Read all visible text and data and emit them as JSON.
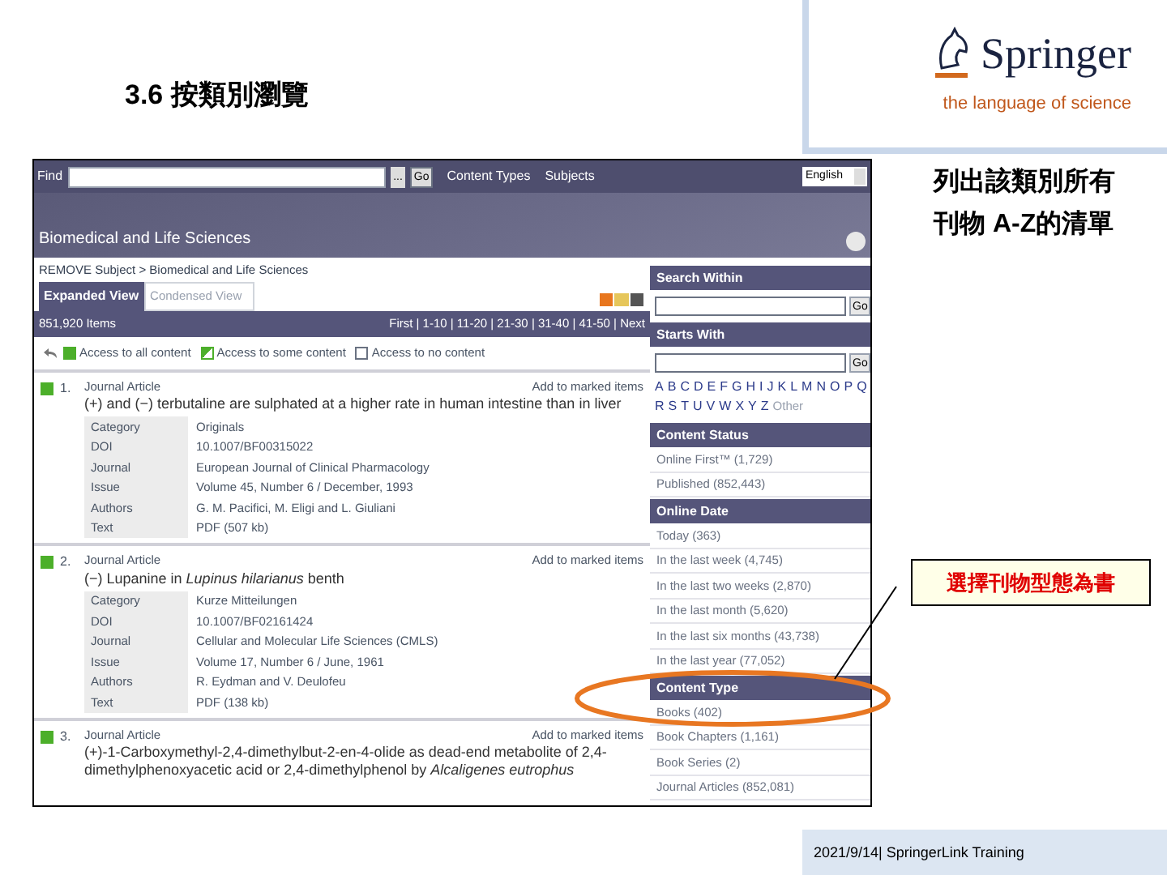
{
  "slide": {
    "title": "3.6 按類別瀏覽",
    "logo": {
      "name": "Springer",
      "tagline": "the language of science"
    },
    "note": "列出該類別所有刊物 A-Z的清單",
    "callout": "選擇刊物型態為書",
    "footer": "2021/9/14| SpringerLink Training"
  },
  "screen": {
    "top_bar": {
      "find_label": "Find",
      "browse_button": "...",
      "go_button": "Go",
      "links": [
        "Content Types",
        "Subjects"
      ],
      "language": "English"
    },
    "banner_title": "Biomedical and Life Sciences",
    "breadcrumb": "REMOVE Subject > Biomedical and Life Sciences",
    "tabs": [
      {
        "label": "Expanded View",
        "selected": true
      },
      {
        "label": "Condensed View",
        "selected": false
      }
    ],
    "result_count": "851,920 Items",
    "pagination": "First | 1-10 | 11-20 | 21-30 | 31-40 | 41-50 | Next",
    "legend": [
      {
        "label": "Access to all content",
        "kind": "all"
      },
      {
        "label": "Access to some content",
        "kind": "some"
      },
      {
        "label": "Access to no content",
        "kind": "none"
      }
    ],
    "results": [
      {
        "number": "1.",
        "kind": "all",
        "type": "Journal Article",
        "action": "Add to marked items",
        "title": "(+) and (−) terbutaline are sulphated at a higher rate in human intestine than in liver",
        "details": [
          {
            "label": "Category",
            "value": "Originals"
          },
          {
            "label": "DOI",
            "value": "10.1007/BF00315022"
          },
          {
            "label": "Journal",
            "value": "European Journal of Clinical Pharmacology"
          },
          {
            "label": "Issue",
            "value": "Volume 45, Number 6 / December, 1993"
          },
          {
            "label": "Authors",
            "value": "G. M. Pacifici, M. Eligi and L. Giuliani"
          },
          {
            "label": "Text",
            "value": "PDF (507 kb)"
          }
        ]
      },
      {
        "number": "2.",
        "kind": "all",
        "type": "Journal Article",
        "action": "Add to marked items",
        "title": "(−) Lupanine in *Lupinus hilarianus* benth",
        "details": [
          {
            "label": "Category",
            "value": "Kurze Mitteilungen"
          },
          {
            "label": "DOI",
            "value": "10.1007/BF02161424"
          },
          {
            "label": "Journal",
            "value": "Cellular and Molecular Life Sciences (CMLS)"
          },
          {
            "label": "Issue",
            "value": "Volume 17, Number 6 / June, 1961"
          },
          {
            "label": "Authors",
            "value": "R. Eydman and V. Deulofeu"
          },
          {
            "label": "Text",
            "value": "PDF (138 kb)"
          }
        ]
      },
      {
        "number": "3.",
        "kind": "all",
        "type": "Journal Article",
        "action": "Add to marked items",
        "title": "(+)-1-Carboxymethyl-2,4-dimethylbut-2-en-4-olide as dead-end metabolite of 2,4-dimethylphenoxyacetic acid or 2,4-dimethylphenol by *Alcaligenes eutrophus*"
      }
    ],
    "sidebar": [
      {
        "kind": "search",
        "heading": "Search Within",
        "button": "Go"
      },
      {
        "kind": "search",
        "heading": "Starts With",
        "button": "Go",
        "letters": [
          {
            "label": "A",
            "disabled": false
          },
          {
            "label": "B",
            "disabled": false
          },
          {
            "label": "C",
            "disabled": false
          },
          {
            "label": "D",
            "disabled": false
          },
          {
            "label": "E",
            "disabled": false
          },
          {
            "label": "F",
            "disabled": false
          },
          {
            "label": "G",
            "disabled": false
          },
          {
            "label": "H",
            "disabled": false
          },
          {
            "label": "I",
            "disabled": false
          },
          {
            "label": "J",
            "disabled": false
          },
          {
            "label": "K",
            "disabled": false
          },
          {
            "label": "L",
            "disabled": false
          },
          {
            "label": "M",
            "disabled": false
          },
          {
            "label": "N",
            "disabled": false
          },
          {
            "label": "O",
            "disabled": false
          },
          {
            "label": "P",
            "disabled": false
          },
          {
            "label": "Q",
            "disabled": false
          },
          {
            "label": "R",
            "disabled": false
          },
          {
            "label": "S",
            "disabled": false
          },
          {
            "label": "T",
            "disabled": false
          },
          {
            "label": "U",
            "disabled": false
          },
          {
            "label": "V",
            "disabled": false
          },
          {
            "label": "W",
            "disabled": false
          },
          {
            "label": "X",
            "disabled": false
          },
          {
            "label": "Y",
            "disabled": false
          },
          {
            "label": "Z",
            "disabled": false
          },
          {
            "label": "Other",
            "disabled": true
          }
        ]
      },
      {
        "kind": "list",
        "heading": "Content Status",
        "items": [
          "Online First™ (1,729)",
          "Published (852,443)"
        ]
      },
      {
        "kind": "list",
        "heading": "Online Date",
        "items": [
          "Today (363)",
          "In the last week (4,745)",
          "In the last two weeks (2,870)",
          "In the last month (5,620)",
          "In the last six months (43,738)",
          "In the last year (77,052)"
        ]
      },
      {
        "kind": "list",
        "heading": "Content Type",
        "items": [
          "Books (402)",
          "Book Chapters (1,161)",
          "Book Series (2)",
          "Journal Articles (852,081)"
        ]
      }
    ]
  }
}
